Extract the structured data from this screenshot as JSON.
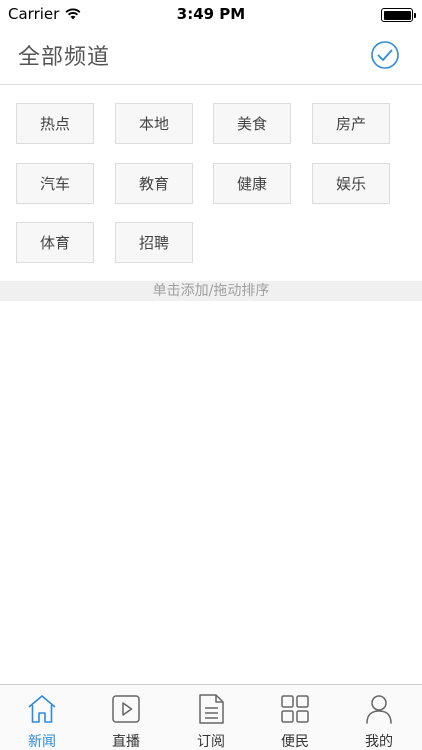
{
  "status_bar": {
    "carrier": "Carrier",
    "time": "3:49 PM",
    "battery_level": 1.0
  },
  "header": {
    "title": "全部频道"
  },
  "channels": [
    "热点",
    "本地",
    "美食",
    "房产",
    "汽车",
    "教育",
    "健康",
    "娱乐",
    "体育",
    "招聘"
  ],
  "hint": "单击添加/拖动排序",
  "tabbar": {
    "tabs": [
      {
        "label": "新闻",
        "icon": "home-icon"
      },
      {
        "label": "直播",
        "icon": "play-icon"
      },
      {
        "label": "订阅",
        "icon": "document-icon"
      },
      {
        "label": "便民",
        "icon": "grid-icon"
      },
      {
        "label": "我的",
        "icon": "user-icon"
      }
    ],
    "active": "新闻"
  },
  "colors": {
    "accent": "#2e8bd8",
    "chip_bg": "#f7f7f7",
    "chip_border": "#dcdcdc",
    "hint_bg": "#f0f0f0"
  }
}
